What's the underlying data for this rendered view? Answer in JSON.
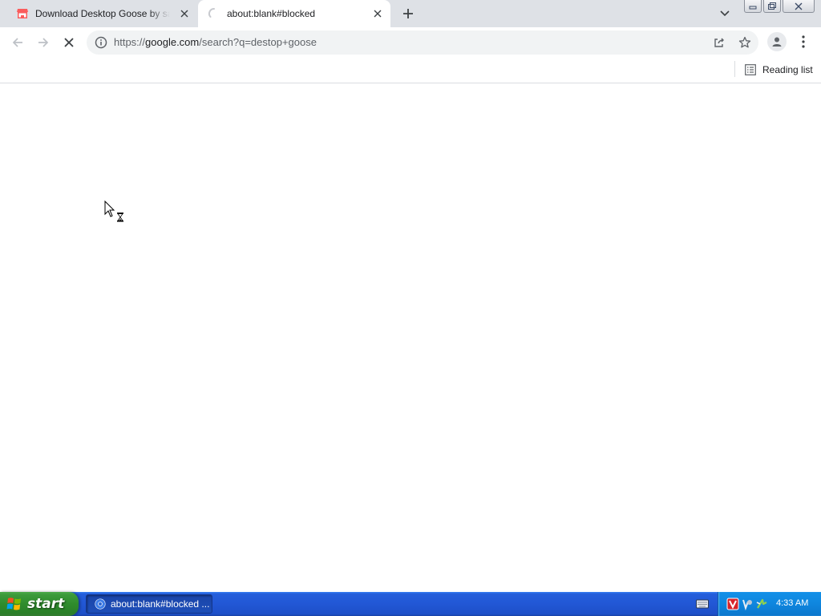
{
  "tabs": [
    {
      "title": "Download Desktop Goose by samperson",
      "favicon": "itchio-store-icon",
      "active": false
    },
    {
      "title": "about:blank#blocked",
      "favicon": "loading-spinner-icon",
      "active": true
    }
  ],
  "toolbar": {
    "url_scheme": "https://",
    "url_host": "google.com",
    "url_rest": "/search?q=destop+goose"
  },
  "bookmarks_bar": {
    "reading_list_label": "Reading list"
  },
  "taskbar": {
    "start_label": "start",
    "task_label": "about:blank#blocked ...",
    "clock": "4:33 AM"
  },
  "colors": {
    "tab_strip": "#dee1e6",
    "omnibox": "#f1f3f4",
    "taskbar_blue": "#245edb",
    "start_green": "#3c9a3a",
    "tray_blue": "#0f86de"
  }
}
